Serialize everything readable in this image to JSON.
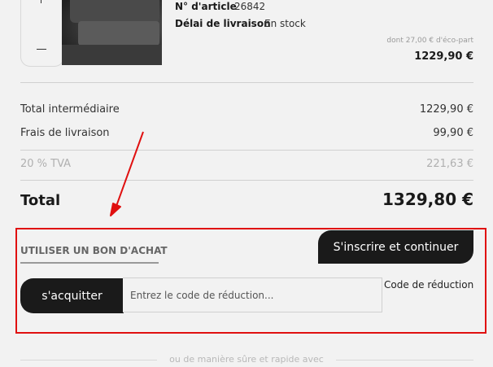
{
  "product": {
    "article_label": "N° d'article",
    "article_value": "26842",
    "delivery_label": "Délai de livraison",
    "delivery_value": "En stock",
    "eco_note": "dont 27,00 € d'éco-part",
    "price": "1229,90 €",
    "qty_plus": "+",
    "qty_minus": "—"
  },
  "summary": {
    "subtotal_label": "Total intermédiaire",
    "subtotal_value": "1229,90 €",
    "shipping_label": "Frais de livraison",
    "shipping_value": "99,90 €",
    "vat_label": "20 % TVA",
    "vat_value": "221,63 €",
    "total_label": "Total",
    "total_value": "1329,80 €"
  },
  "coupon": {
    "title": "UTILISER UN BON D'ACHAT",
    "register_button": "S'inscrire et continuer",
    "apply_button": "s'acquitter",
    "input_placeholder": "Entrez le code de réduction...",
    "input_label": "Code de réduction"
  },
  "footer": {
    "separator_text": "ou de manière sûre et rapide avec"
  },
  "colors": {
    "annotation_red": "#e01010",
    "button_dark": "#1a1a1a"
  }
}
